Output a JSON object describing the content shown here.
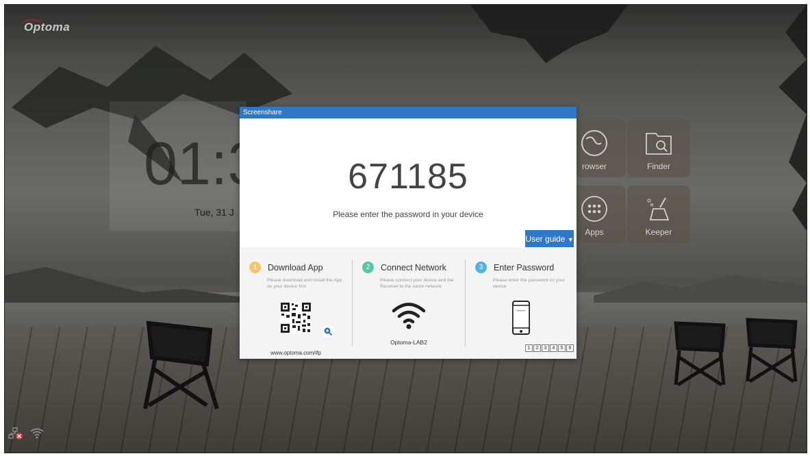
{
  "brand": {
    "logo_text": "Optoma"
  },
  "home": {
    "clock_time": "01:3",
    "clock_date": "Tue, 31 J",
    "tiles": [
      {
        "label": "rowser",
        "icon": "globe-icon"
      },
      {
        "label": "Finder",
        "icon": "folder-search-icon"
      },
      {
        "label": "Apps",
        "icon": "apps-grid-icon"
      },
      {
        "label": "Keeper",
        "icon": "broom-icon"
      }
    ]
  },
  "dialog": {
    "title": "Screenshare",
    "code": "671185",
    "hint": "Please enter the password in your device",
    "user_guide_label": "User guide",
    "steps": [
      {
        "num": "1",
        "title": "Download App",
        "desc": "Please download and install the App on your device first",
        "footer": "www.optoma.com/ifp",
        "color": "#f7c766"
      },
      {
        "num": "2",
        "title": "Connect Network",
        "desc": "Please connect your device and the Receiver to the same network",
        "footer": "Optoma-LAB2",
        "color": "#57c6a8"
      },
      {
        "num": "3",
        "title": "Enter Password",
        "desc": "Please enter the password on your device",
        "footer": "",
        "color": "#4fb3e6"
      }
    ],
    "password_digits": [
      "1",
      "2",
      "3",
      "4",
      "5",
      "6"
    ],
    "phone_screen_text": "••••••"
  },
  "status_bar": {
    "network_icon": "ethernet-disconnected-icon",
    "wifi_icon": "wifi-icon"
  }
}
